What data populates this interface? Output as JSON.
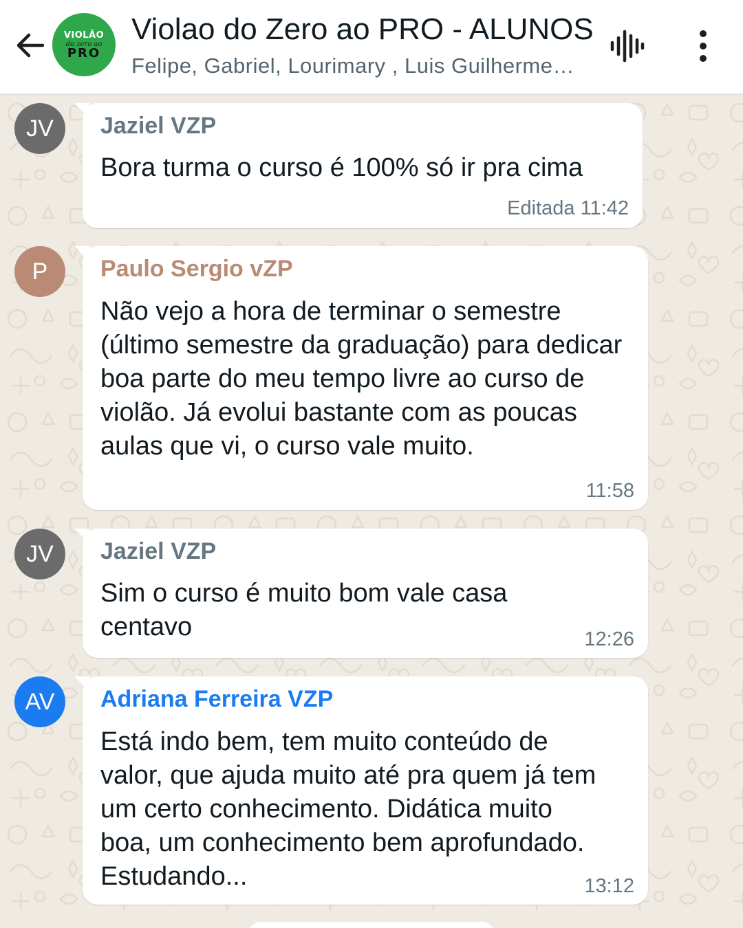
{
  "header": {
    "back_icon": "arrow-left-icon",
    "group_logo": {
      "line1": "VIOLÃO",
      "line2": "do zero ao",
      "line3": "PRO",
      "color": "#2ea84a"
    },
    "title": "Violao do Zero ao PRO - ALUNOS",
    "subtitle": "Felipe, Gabriel, Lourimary , Luis Guilherme, Marcos",
    "voice_icon": "voice-chat-waveform-icon",
    "menu_icon": "more-vertical-icon"
  },
  "messages": [
    {
      "avatar": "JV",
      "avatar_color": "#6b6b6b",
      "sender": "Jaziel VZP",
      "sender_color": "#667781",
      "text": "Bora turma o curso é 100% só ir pra cima",
      "time": "Editada 11:42"
    },
    {
      "avatar": "P",
      "avatar_color": "#b98a74",
      "sender": "Paulo Sergio vZP",
      "sender_color": "#b98a74",
      "text": "Não vejo a hora de terminar o semestre (último semestre da graduação) para dedicar boa parte do meu tempo livre ao curso de violão. Já evolui bastante com as poucas aulas que vi, o curso vale muito.",
      "time": "11:58"
    },
    {
      "avatar": "JV",
      "avatar_color": "#6b6b6b",
      "sender": "Jaziel VZP",
      "sender_color": "#667781",
      "text": "Sim o curso é muito bom vale casa centavo",
      "time": "12:26"
    },
    {
      "avatar": "AV",
      "avatar_color": "#1b7cf2",
      "sender": "Adriana Ferreira VZP",
      "sender_color": "#1b7cf2",
      "text": "Está indo bem, tem muito conteúdo de valor, que ajuda muito até pra quem já tem um certo conhecimento.  Didática muito boa, um conhecimento bem aprofundado. Estudando...",
      "time": "13:12"
    }
  ],
  "colors": {
    "chat_background": "#efeae2",
    "bubble": "#ffffff",
    "header": "#ffffff"
  }
}
